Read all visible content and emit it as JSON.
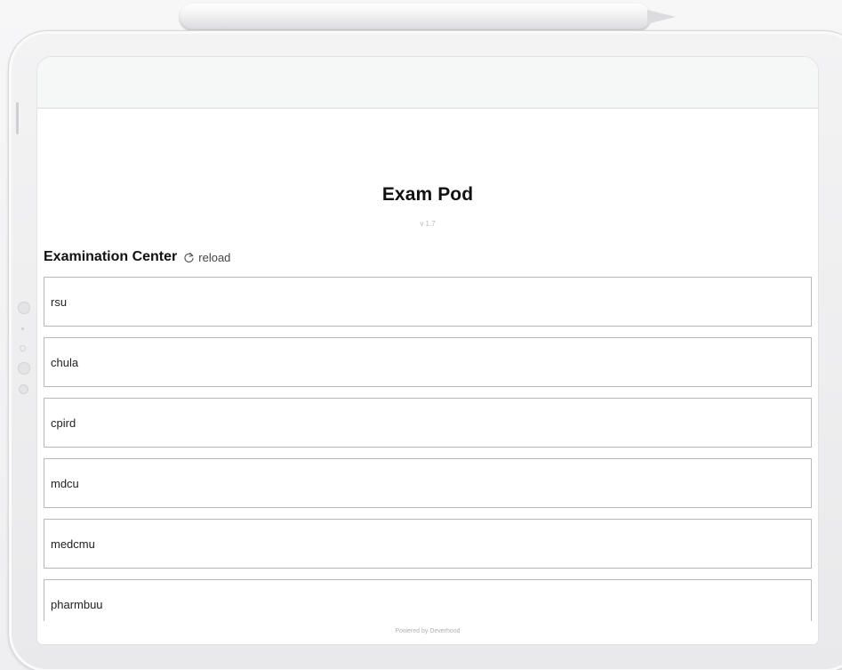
{
  "app": {
    "title": "Exam Pod",
    "version": "v 1.7"
  },
  "section": {
    "title": "Examination Center",
    "reload_label": "reload",
    "reload_icon": "reload-icon"
  },
  "centers": [
    {
      "label": "rsu"
    },
    {
      "label": "chula"
    },
    {
      "label": "cpird"
    },
    {
      "label": "mdcu"
    },
    {
      "label": "medcmu"
    },
    {
      "label": "pharmbuu"
    }
  ],
  "footer": {
    "text": "Powered by Deverhood"
  },
  "colors": {
    "border": "#b9b9bd",
    "title": "#111111",
    "topbar": "#f6f7f7"
  }
}
